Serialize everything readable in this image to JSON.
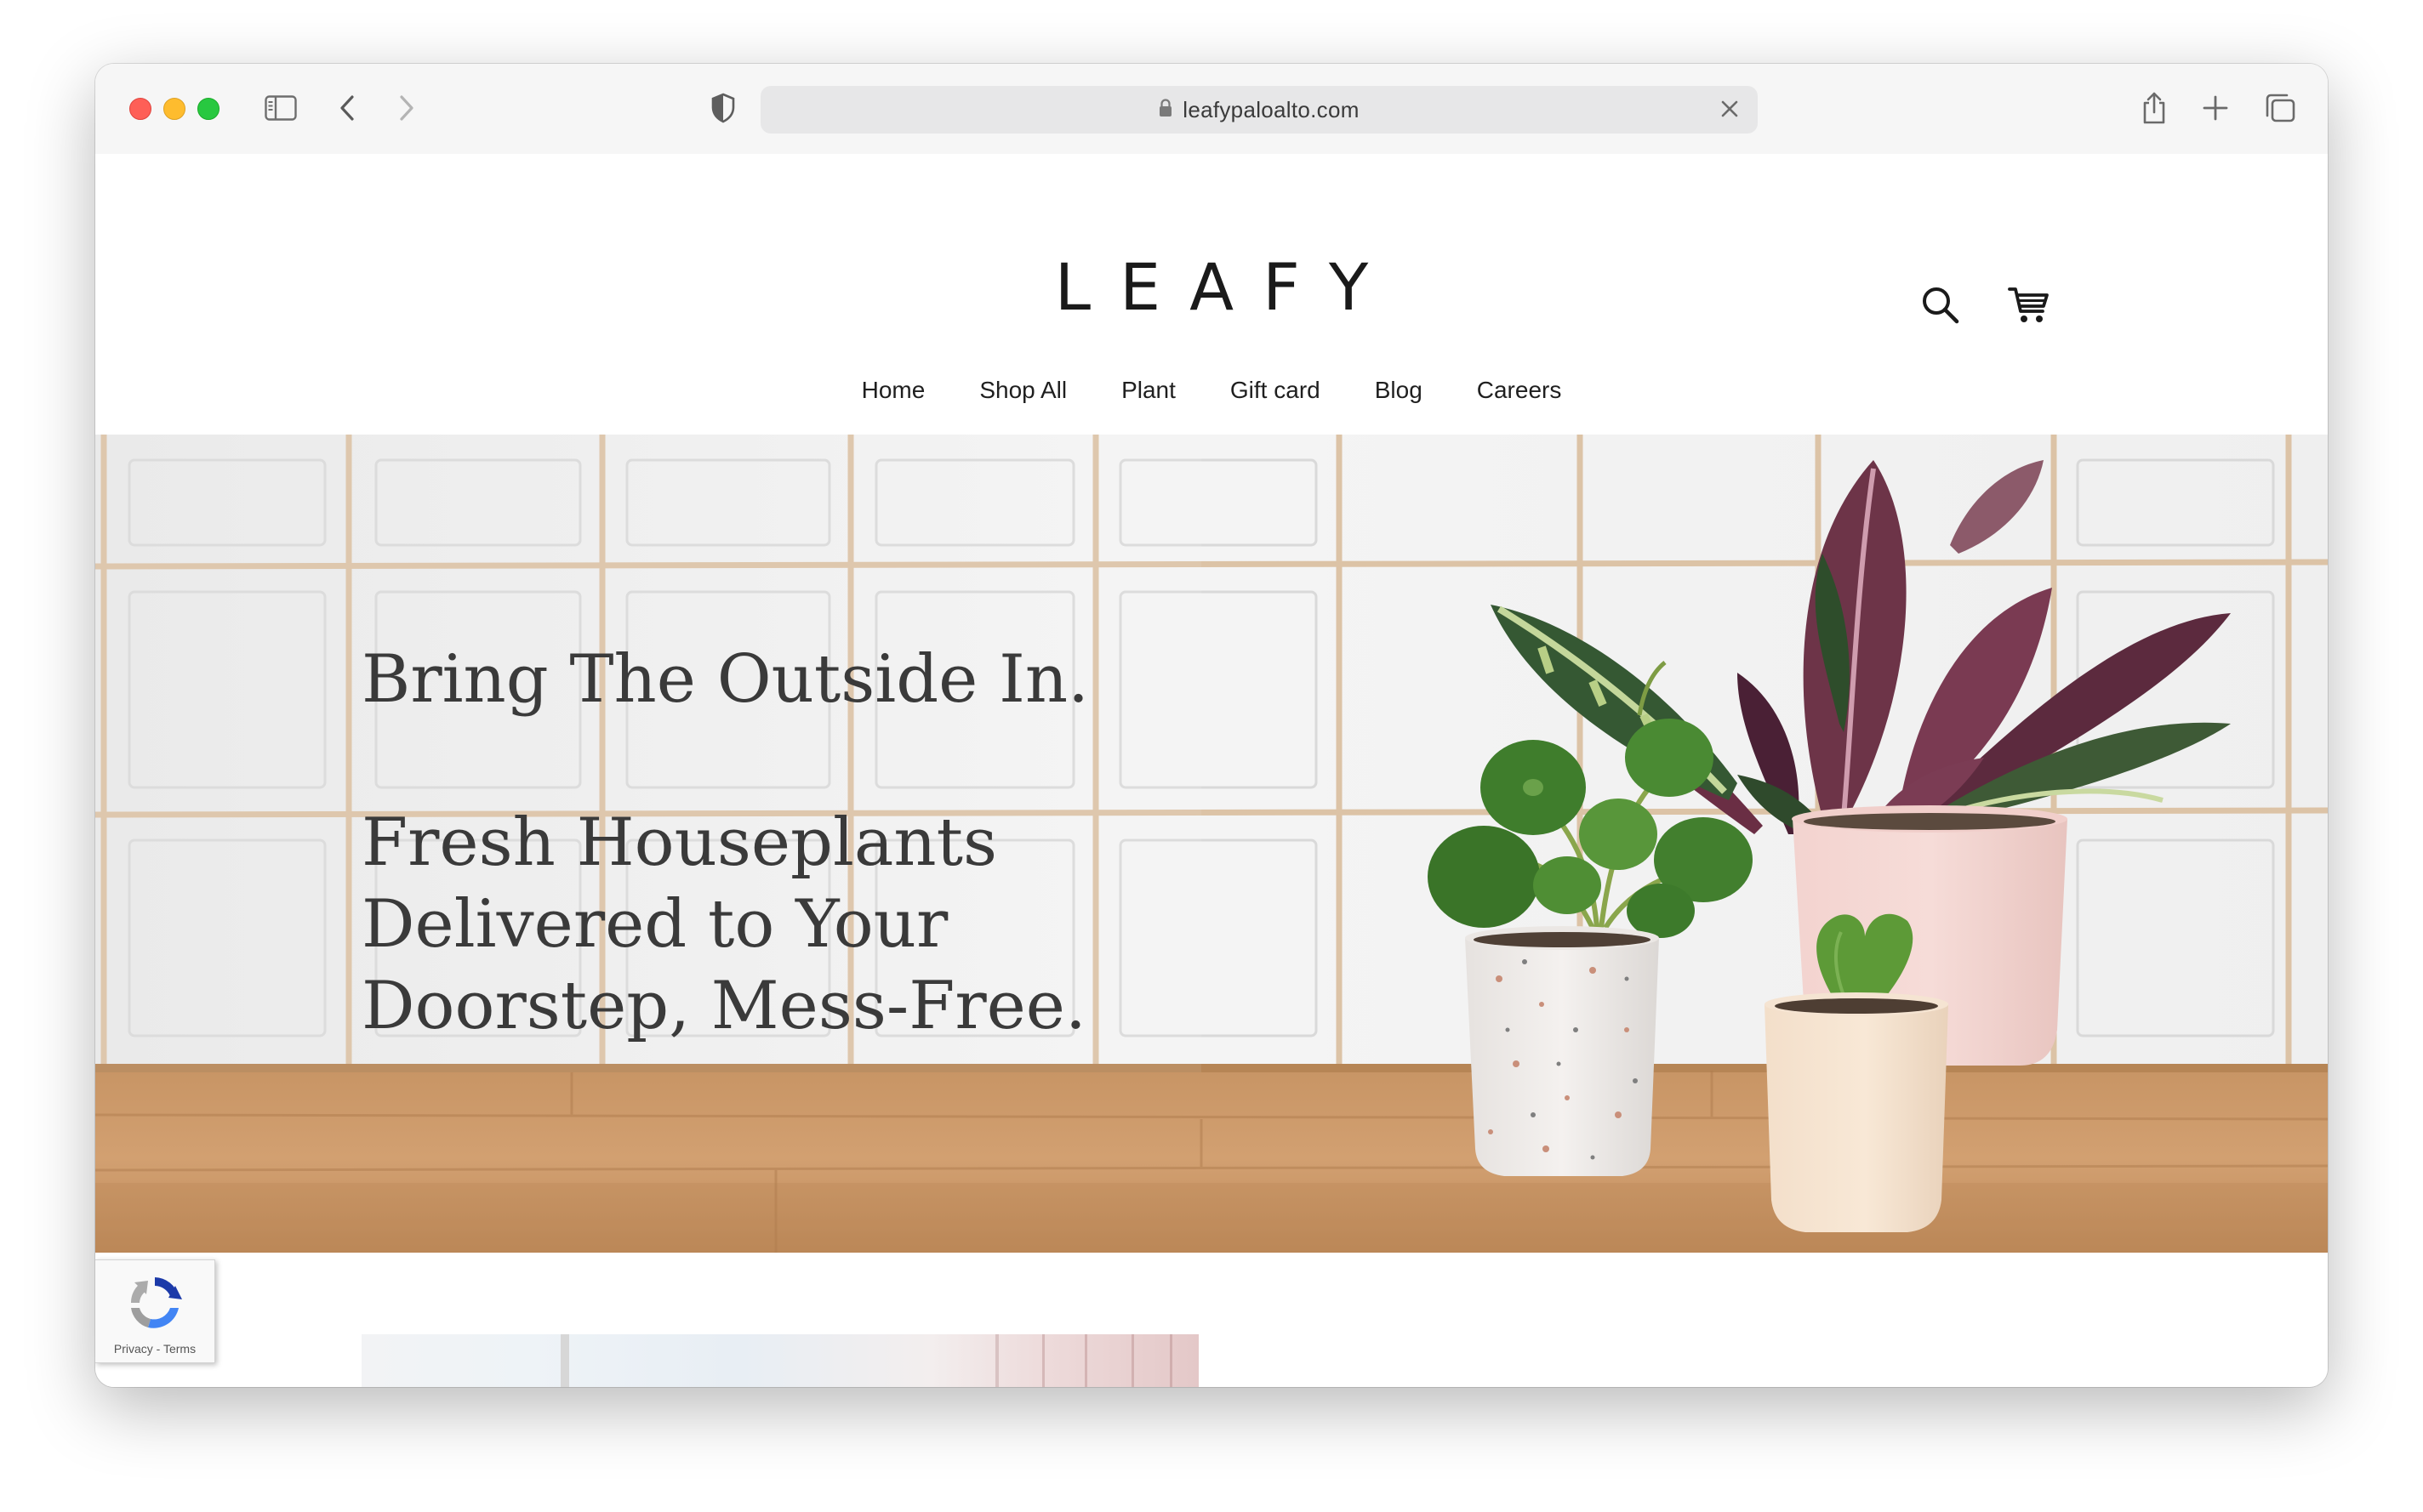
{
  "browser": {
    "url": "leafypaloalto.com"
  },
  "site": {
    "logo": "LEAFY",
    "nav": [
      "Home",
      "Shop All",
      "Plant",
      "Gift card",
      "Blog",
      "Careers"
    ]
  },
  "hero": {
    "tagline": "Bring The Outside In.",
    "headline_lines": [
      "Fresh Houseplants",
      "Delivered to Your",
      "Doorstep, Mess-Free."
    ]
  },
  "recaptcha": {
    "privacy": "Privacy",
    "separator": " - ",
    "terms": "Terms"
  }
}
